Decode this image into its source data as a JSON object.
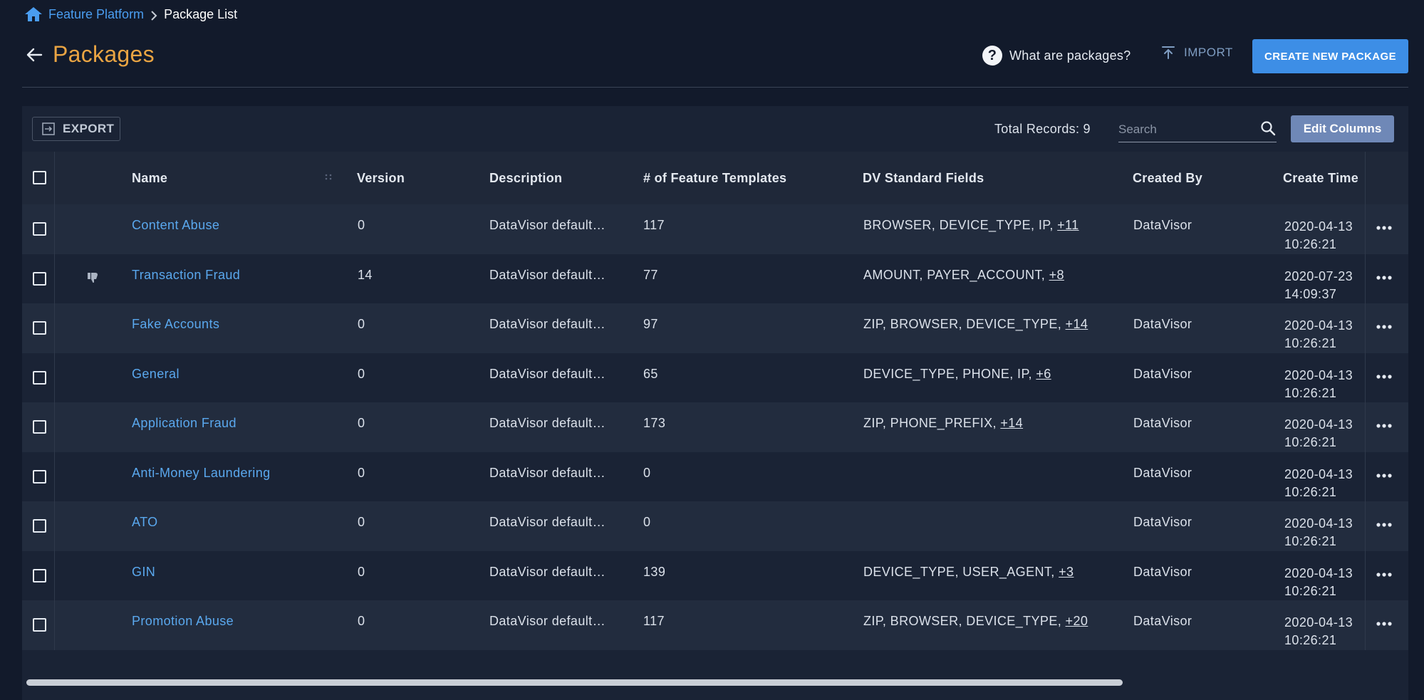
{
  "breadcrumb": {
    "items": [
      "Feature Platform",
      "Package List"
    ]
  },
  "header": {
    "title": "Packages",
    "help_label": "What are packages?",
    "help_icon_glyph": "?",
    "import_label": "IMPORT",
    "create_label": "CREATE NEW PACKAGE"
  },
  "toolbar": {
    "export_label": "EXPORT",
    "total_records": "Total Records: 9",
    "search_placeholder": "Search",
    "edit_columns_label": "Edit Columns"
  },
  "table": {
    "columns": [
      "Name",
      "Version",
      "Description",
      "# of Feature Templates",
      "DV Standard Fields",
      "Created By",
      "Create Time"
    ],
    "rows": [
      {
        "name": "Content Abuse",
        "version": "0",
        "description": "DataVisor default …",
        "templates": "117",
        "fields": "BROWSER, DEVICE_TYPE, IP, ",
        "fields_more": "+11",
        "created_by": "DataVisor",
        "date": "2020-04-13",
        "time": "10:26:21",
        "icon": ""
      },
      {
        "name": "Transaction Fraud",
        "version": "14",
        "description": "DataVisor default …",
        "templates": "77",
        "fields": "AMOUNT, PAYER_ACCOUNT, ",
        "fields_more": "+8",
        "created_by": "",
        "date": "2020-07-23",
        "time": "14:09:37",
        "icon": "thumbs-down-icon"
      },
      {
        "name": "Fake Accounts",
        "version": "0",
        "description": "DataVisor default …",
        "templates": "97",
        "fields": "ZIP, BROWSER, DEVICE_TYPE, ",
        "fields_more": "+14",
        "created_by": "DataVisor",
        "date": "2020-04-13",
        "time": "10:26:21",
        "icon": ""
      },
      {
        "name": "General",
        "version": "0",
        "description": "DataVisor default …",
        "templates": "65",
        "fields": "DEVICE_TYPE, PHONE, IP, ",
        "fields_more": "+6",
        "created_by": "DataVisor",
        "date": "2020-04-13",
        "time": "10:26:21",
        "icon": ""
      },
      {
        "name": "Application Fraud",
        "version": "0",
        "description": "DataVisor default …",
        "templates": "173",
        "fields": "ZIP, PHONE_PREFIX, ",
        "fields_more": "+14",
        "created_by": "DataVisor",
        "date": "2020-04-13",
        "time": "10:26:21",
        "icon": ""
      },
      {
        "name": "Anti-Money Laundering",
        "version": "0",
        "description": "DataVisor default …",
        "templates": "0",
        "fields": "",
        "fields_more": "",
        "created_by": "DataVisor",
        "date": "2020-04-13",
        "time": "10:26:21",
        "icon": ""
      },
      {
        "name": "ATO",
        "version": "0",
        "description": "DataVisor default …",
        "templates": "0",
        "fields": "",
        "fields_more": "",
        "created_by": "DataVisor",
        "date": "2020-04-13",
        "time": "10:26:21",
        "icon": ""
      },
      {
        "name": "GIN",
        "version": "0",
        "description": "DataVisor default …",
        "templates": "139",
        "fields": "DEVICE_TYPE, USER_AGENT, ",
        "fields_more": "+3",
        "created_by": "DataVisor",
        "date": "2020-04-13",
        "time": "10:26:21",
        "icon": ""
      },
      {
        "name": "Promotion Abuse",
        "version": "0",
        "description": "DataVisor default …",
        "templates": "117",
        "fields": "ZIP, BROWSER, DEVICE_TYPE, ",
        "fields_more": "+20",
        "created_by": "DataVisor",
        "date": "2020-04-13",
        "time": "10:26:21",
        "icon": ""
      }
    ]
  },
  "colors": {
    "background": "#121a2b",
    "panel": "#1a2335",
    "accent": "#3d8ee6",
    "title": "#e9a443",
    "link": "#5aa8ee"
  }
}
